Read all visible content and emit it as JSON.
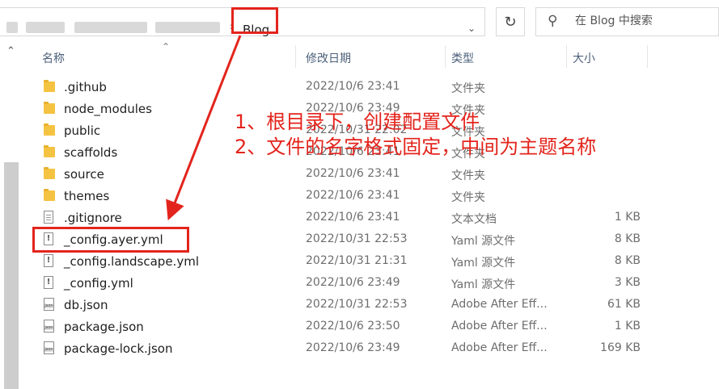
{
  "address_bar": {
    "current_folder": "Blog",
    "separator": "›",
    "dropdown_icon": "chevron-down-icon"
  },
  "refresh_icon": "refresh-icon",
  "search": {
    "placeholder": "在 Blog 中搜索",
    "value": ""
  },
  "columns": {
    "name": "名称",
    "date": "修改日期",
    "type": "类型",
    "size": "大小"
  },
  "files": [
    {
      "name": ".github",
      "date": "2022/10/6 23:41",
      "type": "文件夹",
      "size": "",
      "icon": "folder-icon"
    },
    {
      "name": "node_modules",
      "date": "2022/10/6 23:49",
      "type": "文件夹",
      "size": "",
      "icon": "folder-icon"
    },
    {
      "name": "public",
      "date": "2022/10/31 22:02",
      "type": "文件夹",
      "size": "",
      "icon": "folder-icon"
    },
    {
      "name": "scaffolds",
      "date": "2022/10/6 23:41",
      "type": "文件夹",
      "size": "",
      "icon": "folder-icon"
    },
    {
      "name": "source",
      "date": "2022/10/6 23:41",
      "type": "文件夹",
      "size": "",
      "icon": "folder-icon"
    },
    {
      "name": "themes",
      "date": "2022/10/6 23:41",
      "type": "文件夹",
      "size": "",
      "icon": "folder-icon"
    },
    {
      "name": ".gitignore",
      "date": "2022/10/6 23:41",
      "type": "文本文档",
      "size": "1 KB",
      "icon": "text-file-icon"
    },
    {
      "name": "_config.ayer.yml",
      "date": "2022/10/31 22:53",
      "type": "Yaml 源文件",
      "size": "8 KB",
      "icon": "yaml-file-icon"
    },
    {
      "name": "_config.landscape.yml",
      "date": "2022/10/31 21:31",
      "type": "Yaml 源文件",
      "size": "8 KB",
      "icon": "yaml-file-icon"
    },
    {
      "name": "_config.yml",
      "date": "2022/10/6 23:49",
      "type": "Yaml 源文件",
      "size": "3 KB",
      "icon": "yaml-file-icon"
    },
    {
      "name": "db.json",
      "date": "2022/10/31 22:53",
      "type": "Adobe After Eff...",
      "size": "61 KB",
      "icon": "json-file-icon"
    },
    {
      "name": "package.json",
      "date": "2022/10/6 23:50",
      "type": "Adobe After Eff...",
      "size": "1 KB",
      "icon": "json-file-icon"
    },
    {
      "name": "package-lock.json",
      "date": "2022/10/6 23:49",
      "type": "Adobe After Eff...",
      "size": "169 KB",
      "icon": "json-file-icon"
    }
  ],
  "annotations": {
    "line1": "1、根目录下，创建配置文件",
    "line2": "2、文件的名字格式固定，中间为主题名称",
    "color": "#e3241c"
  }
}
